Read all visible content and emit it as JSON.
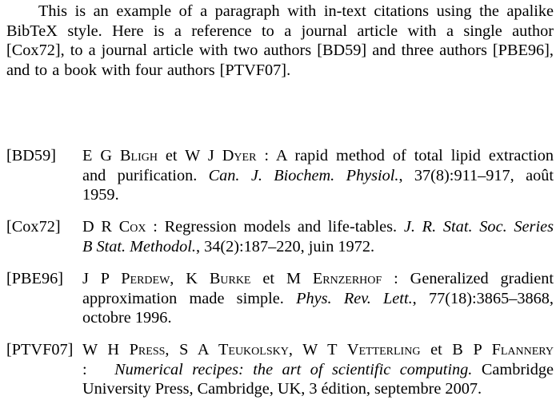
{
  "paragraph": {
    "lines": [
      "This is an example of a paragraph with in-text citations using the apalike",
      "BibTeX style.  Here is a reference to a journal article with a single author",
      "[Cox72], to a journal article with two authors [BD59] and three authors [PBE96],",
      "and to a book with four authors [PTVF07]."
    ],
    "citations": [
      "[Cox72]",
      "[BD59]",
      "[PBE96]",
      "[PTVF07]"
    ]
  },
  "bibliography": [
    {
      "label": "[BD59]",
      "authors": "E G Bligh et W J Dyer",
      "author_parts": [
        {
          "text": "E G ",
          "sc": false
        },
        {
          "text": "Bligh",
          "sc": true
        },
        {
          "text": " et W J ",
          "sc": false
        },
        {
          "text": "Dyer",
          "sc": true
        }
      ],
      "separator": " : ",
      "title": "A rapid method of total lipid extraction and purification.",
      "venue": "Can. J. Biochem. Physiol.",
      "details": ", 37(8):911–917, août 1959.",
      "lines": [
        "A rapid method of total lipid extraction",
        "and purification.",
        "Can. J. Biochem. Physiol.",
        ", 37(8):911–917, août",
        "1959."
      ]
    },
    {
      "label": "[Cox72]",
      "authors": "D R Cox",
      "author_parts": [
        {
          "text": "D R ",
          "sc": false
        },
        {
          "text": "Cox",
          "sc": true
        }
      ],
      "separator": " : ",
      "title": "Regression models and life-tables.",
      "venue": "J. R. Stat. Soc. Series B Stat. Methodol.",
      "details": ", 34(2):187–220, juin 1972.",
      "lines": [
        "Regression models and life-tables.",
        "J. R. Stat. Soc. Series",
        "B Stat. Methodol.",
        ", 34(2):187–220, juin 1972."
      ]
    },
    {
      "label": "[PBE96]",
      "authors": "J P Perdew, K Burke et M Ernzerhof",
      "author_parts": [
        {
          "text": "J P ",
          "sc": false
        },
        {
          "text": "Perdew",
          "sc": true
        },
        {
          "text": ", K ",
          "sc": false
        },
        {
          "text": "Burke",
          "sc": true
        },
        {
          "text": " et M ",
          "sc": false
        },
        {
          "text": "Ernzerhof",
          "sc": true
        }
      ],
      "separator": " : ",
      "title": "Generalized gradient approximation made simple.",
      "venue": "Phys. Rev. Lett.",
      "details": ", 77(18):3865–3868, octobre 1996.",
      "lines": [
        "Generalized gradient",
        "approximation made simple.",
        "Phys. Rev. Lett.",
        ", 77(18):3865–3868,",
        "octobre 1996."
      ]
    },
    {
      "label": "[PTVF07]",
      "authors": "W H Press, S A Teukolsky, W T Vetterling et B P Flannery",
      "author_parts": [
        {
          "text": "W H ",
          "sc": false
        },
        {
          "text": "Press",
          "sc": true
        },
        {
          "text": ", S A ",
          "sc": false
        },
        {
          "text": "Teukolsky",
          "sc": true
        },
        {
          "text": ", W T ",
          "sc": false
        },
        {
          "text": "Vetterling",
          "sc": true
        },
        {
          "text": " et B P ",
          "sc": false
        },
        {
          "text": "Flannery",
          "sc": true
        }
      ],
      "separator": ":",
      "title": "Numerical recipes: the art of scientific computing.",
      "publisher": "Cambridge University Press, Cambridge, UK, 3 édition, septembre 2007.",
      "lines": [
        ":",
        "Numerical recipes: the art of scientific computing.",
        "Cambridge",
        "University Press, Cambridge, UK, 3 édition, septembre 2007."
      ]
    }
  ]
}
